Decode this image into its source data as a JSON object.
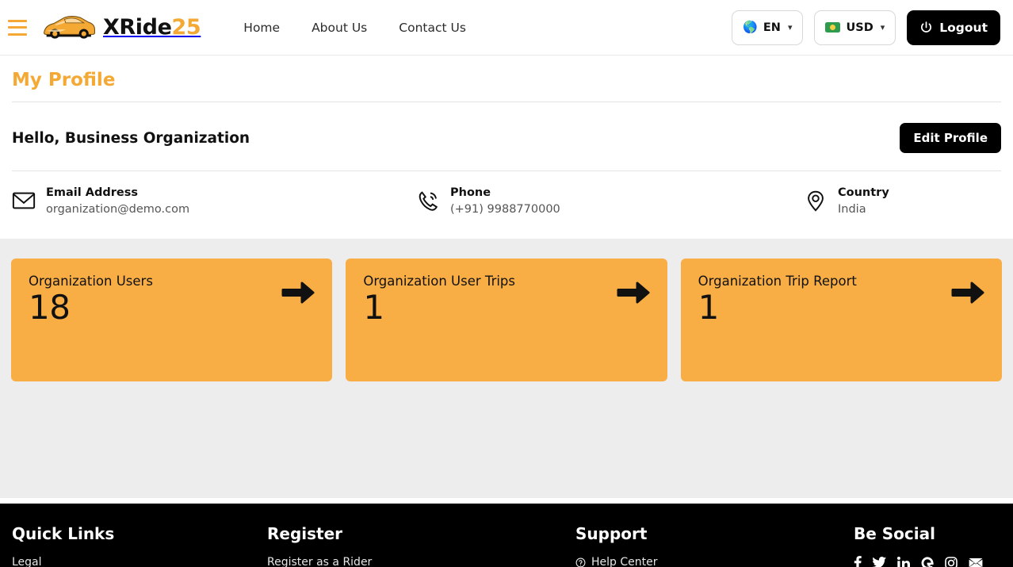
{
  "header": {
    "menu_icon": "hamburger-menu-icon",
    "brand": {
      "part1": "XRide",
      "part2": "25",
      "logo_icon": "car-logo-icon"
    },
    "nav": [
      {
        "label": "Home"
      },
      {
        "label": "About Us"
      },
      {
        "label": "Contact Us"
      }
    ],
    "language": {
      "value": "EN",
      "icon": "globe-icon",
      "caret": "⌄"
    },
    "currency": {
      "value": "USD",
      "icon": "money-icon",
      "caret": "⌄"
    },
    "logout": {
      "label": "Logout",
      "icon": "power-icon"
    }
  },
  "profile": {
    "page_title": "My Profile",
    "greeting": "Hello, Business Organization",
    "edit_button": "Edit Profile",
    "contacts": [
      {
        "icon": "envelope-icon",
        "label": "Email Address",
        "value": "organization@demo.com"
      },
      {
        "icon": "phone-icon",
        "label": "Phone",
        "value": "(+91) 9988770000"
      },
      {
        "icon": "location-pin-icon",
        "label": "Country",
        "value": "India"
      }
    ]
  },
  "stats": {
    "cards": [
      {
        "label": "Organization Users",
        "value": "18",
        "arrow_icon": "arrow-right-icon"
      },
      {
        "label": "Organization User Trips",
        "value": "1",
        "arrow_icon": "arrow-right-icon"
      },
      {
        "label": "Organization Trip Report",
        "value": "1",
        "arrow_icon": "arrow-right-icon"
      }
    ]
  },
  "footer": {
    "columns": [
      {
        "heading": "Quick Links",
        "links": [
          {
            "label": "Legal"
          }
        ]
      },
      {
        "heading": "Register",
        "links": [
          {
            "label": "Register as a Rider"
          }
        ]
      },
      {
        "heading": "Support",
        "links": [
          {
            "label": "Help Center",
            "icon": "question-circle-icon"
          }
        ]
      },
      {
        "heading": "Be Social",
        "socials": [
          {
            "name": "facebook-icon"
          },
          {
            "name": "twitter-icon"
          },
          {
            "name": "linkedin-icon"
          },
          {
            "name": "google-icon"
          },
          {
            "name": "instagram-icon"
          },
          {
            "name": "mail-icon"
          }
        ]
      }
    ]
  },
  "colors": {
    "accent": "#F5A935",
    "card": "#F8AE45",
    "stats_bg": "#ededed",
    "footer_bg": "#000000"
  }
}
